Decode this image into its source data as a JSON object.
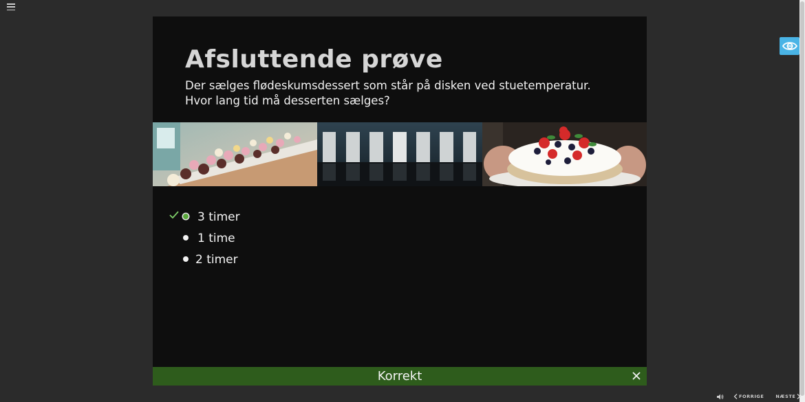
{
  "slide": {
    "title": "Afsluttende prøve",
    "question_line1": "Der sælges flødeskumsdessert som står på disken ved stuetemperatur.",
    "question_line2": "Hvor lang tid må desserten sælges?"
  },
  "images": [
    {
      "icon": "cupcakes-display-image"
    },
    {
      "icon": "doors-hallway-image"
    },
    {
      "icon": "berry-cake-image"
    }
  ],
  "answers": [
    {
      "label": "3 timer",
      "selected": true,
      "correct": true
    },
    {
      "label": "1 time",
      "selected": false,
      "correct": false
    },
    {
      "label": "2 timer",
      "selected": false,
      "correct": false
    }
  ],
  "feedback": {
    "text": "Korrekt",
    "color": "#2e5c1c"
  },
  "player": {
    "prev_label": "FORRIGE",
    "next_label": "NÆSTE"
  },
  "colors": {
    "accessibility": "#4ab4e6",
    "selected_radio": "#5aa83c"
  }
}
